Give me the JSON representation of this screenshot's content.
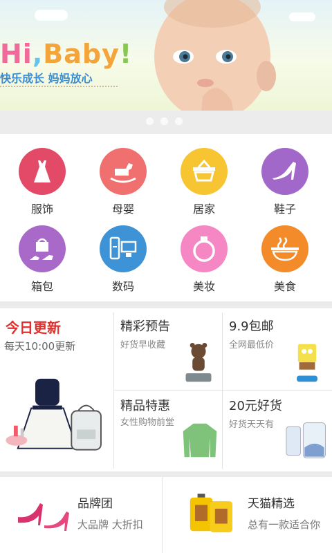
{
  "banner": {
    "headline_parts": [
      "Hi",
      ",",
      "Baby",
      "!"
    ],
    "subtitle": "快乐成长 妈妈放心",
    "carousel_dots": 3
  },
  "categories": [
    {
      "label": "服饰",
      "icon": "dress-icon",
      "color": "#e24a68"
    },
    {
      "label": "母婴",
      "icon": "rocking-horse-icon",
      "color": "#f06f6f"
    },
    {
      "label": "居家",
      "icon": "basket-icon",
      "color": "#f7c531"
    },
    {
      "label": "鞋子",
      "icon": "high-heel-icon",
      "color": "#a268c9"
    },
    {
      "label": "箱包",
      "icon": "bag-icon",
      "color": "#a969c9"
    },
    {
      "label": "数码",
      "icon": "devices-icon",
      "color": "#3d93d6"
    },
    {
      "label": "美妆",
      "icon": "ring-icon",
      "color": "#f588c4"
    },
    {
      "label": "美食",
      "icon": "noodle-bowl-icon",
      "color": "#f38b2a"
    }
  ],
  "promo": {
    "today": {
      "title": "今日更新",
      "subtitle": "每天10:00更新"
    },
    "tiles": [
      {
        "title": "精彩预告",
        "subtitle": "好货早收藏"
      },
      {
        "title": "9.9包邮",
        "subtitle": "全网最低价"
      },
      {
        "title": "精品特惠",
        "subtitle": "女性购物前堂"
      },
      {
        "title": "20元好货",
        "subtitle": "好货天天有"
      }
    ]
  },
  "bottom": [
    {
      "title": "品牌团",
      "subtitle": "大品牌 大折扣"
    },
    {
      "title": "天猫精选",
      "subtitle": "总有一款适合你"
    }
  ]
}
